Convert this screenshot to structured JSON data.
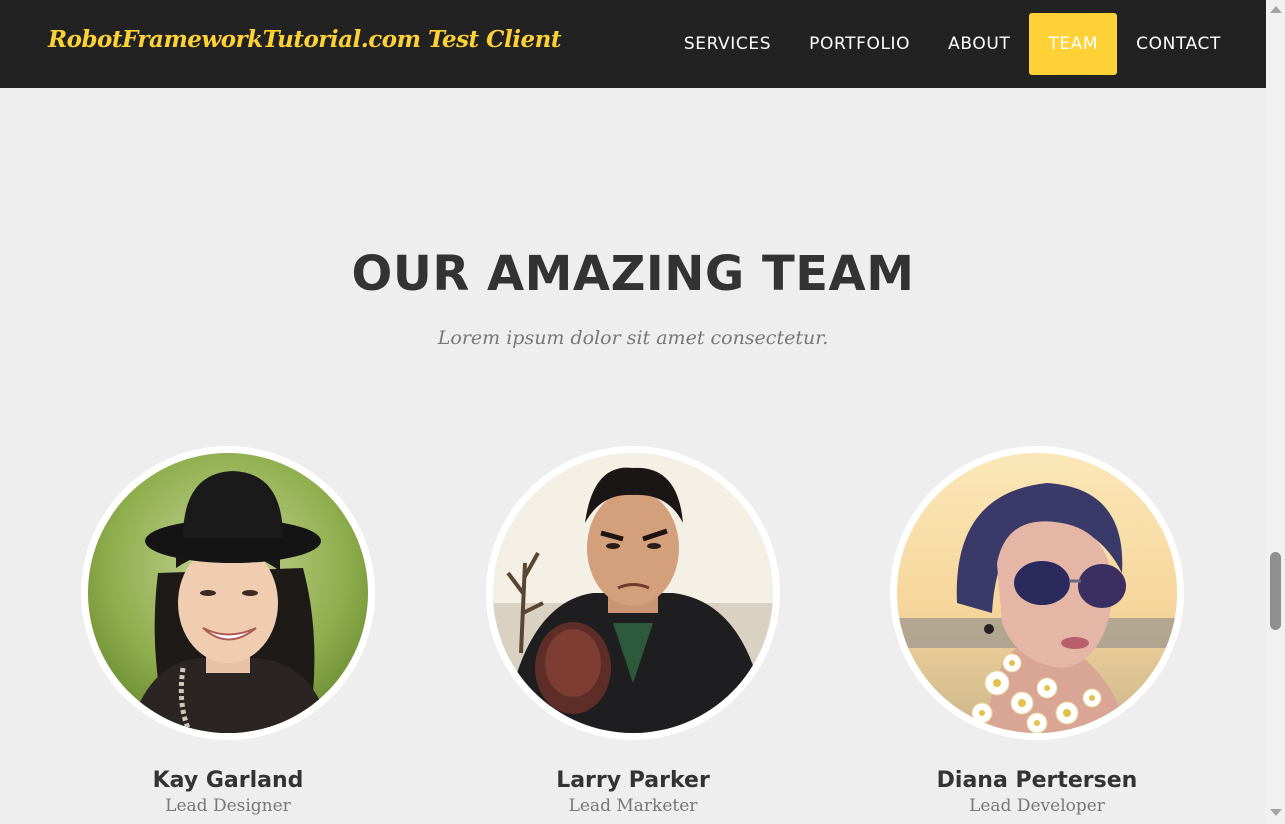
{
  "navbar": {
    "brand": "RobotFrameworkTutorial.com Test Client",
    "items": [
      {
        "label": "SERVICES",
        "active": false
      },
      {
        "label": "PORTFOLIO",
        "active": false
      },
      {
        "label": "ABOUT",
        "active": false
      },
      {
        "label": "TEAM",
        "active": true
      },
      {
        "label": "CONTACT",
        "active": false
      }
    ]
  },
  "team": {
    "title": "OUR AMAZING TEAM",
    "subtitle": "Lorem ipsum dolor sit amet consectetur.",
    "members": [
      {
        "name": "Kay Garland",
        "role": "Lead Designer"
      },
      {
        "name": "Larry Parker",
        "role": "Lead Marketer"
      },
      {
        "name": "Diana Pertersen",
        "role": "Lead Developer"
      }
    ]
  },
  "colors": {
    "nav_bg": "#222222",
    "accent": "#fed136",
    "page_bg": "#eeeeee",
    "heading": "#333333",
    "muted": "#777777"
  }
}
